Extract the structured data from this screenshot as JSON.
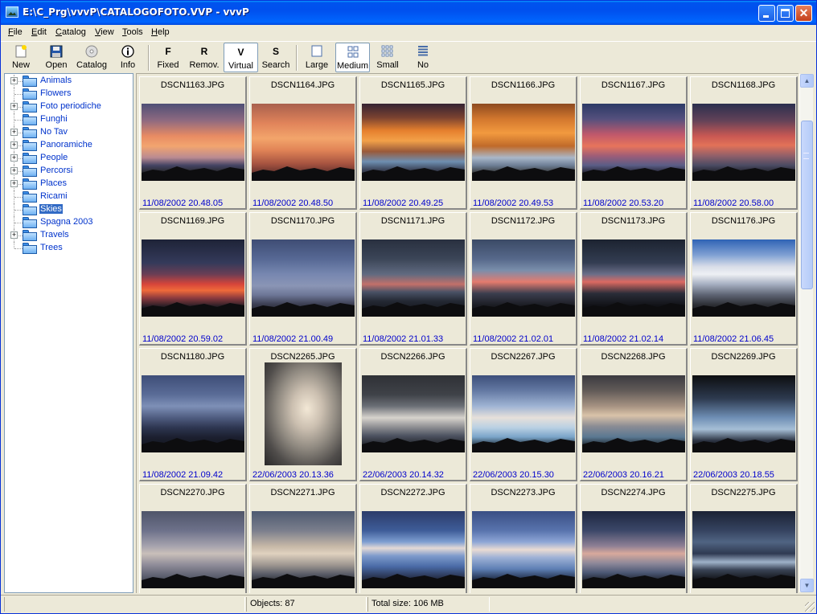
{
  "window": {
    "title": "E:\\C_Prg\\vvvP\\CATALOGOFOTO.VVP - vvvP"
  },
  "menu": [
    {
      "label": "File",
      "accel": "F",
      "rest": "ile"
    },
    {
      "label": "Edit",
      "accel": "E",
      "rest": "dit"
    },
    {
      "label": "Catalog",
      "accel": "C",
      "rest": "atalog"
    },
    {
      "label": "View",
      "accel": "V",
      "rest": "iew"
    },
    {
      "label": "Tools",
      "accel": "T",
      "rest": "ools"
    },
    {
      "label": "Help",
      "accel": "H",
      "rest": "elp"
    }
  ],
  "toolbar": {
    "new": "New",
    "open": "Open",
    "catalog": "Catalog",
    "info": "Info",
    "fixed_letter": "F",
    "fixed": "Fixed",
    "removable_letter": "R",
    "removable": "Remov.",
    "virtual_letter": "V",
    "virtual": "Virtual",
    "search_letter": "S",
    "search": "Search",
    "large": "Large",
    "medium": "Medium",
    "small": "Small",
    "no": "No",
    "active_items": [
      "Virtual",
      "Medium"
    ]
  },
  "tree": [
    {
      "label": "Animals",
      "expandable": true
    },
    {
      "label": "Flowers",
      "expandable": false
    },
    {
      "label": "Foto periodiche",
      "expandable": true
    },
    {
      "label": "Funghi",
      "expandable": false
    },
    {
      "label": "No Tav",
      "expandable": true
    },
    {
      "label": "Panoramiche",
      "expandable": true
    },
    {
      "label": "People",
      "expandable": true
    },
    {
      "label": "Percorsi",
      "expandable": true
    },
    {
      "label": "Places",
      "expandable": true
    },
    {
      "label": "Ricami",
      "expandable": false
    },
    {
      "label": "Skies",
      "expandable": false,
      "selected": true
    },
    {
      "label": "Spagna 2003",
      "expandable": false
    },
    {
      "label": "Travels",
      "expandable": true
    },
    {
      "label": "Trees",
      "expandable": false
    }
  ],
  "thumbnails": [
    {
      "name": "DSCN1163.JPG",
      "date": "11/08/2002 20.48.05",
      "style": "orange-sky"
    },
    {
      "name": "DSCN1164.JPG",
      "date": "11/08/2002 20.48.50",
      "style": "orange-full"
    },
    {
      "name": "DSCN1165.JPG",
      "date": "11/08/2002 20.49.25",
      "style": "orange-dramatic"
    },
    {
      "name": "DSCN1166.JPG",
      "date": "11/08/2002 20.49.53",
      "style": "orange-dramatic2"
    },
    {
      "name": "DSCN1167.JPG",
      "date": "11/08/2002 20.53.20",
      "style": "red-dusk"
    },
    {
      "name": "DSCN1168.JPG",
      "date": "11/08/2002 20.58.00",
      "style": "red-dusk-tree"
    },
    {
      "name": "DSCN1169.JPG",
      "date": "11/08/2002 20.59.02",
      "style": "red-band"
    },
    {
      "name": "DSCN1170.JPG",
      "date": "11/08/2002 21.00.49",
      "style": "blue-dusk"
    },
    {
      "name": "DSCN1171.JPG",
      "date": "11/08/2002 21.01.33",
      "style": "dark-cloud"
    },
    {
      "name": "DSCN1172.JPG",
      "date": "11/08/2002 21.02.01",
      "style": "dark-pink"
    },
    {
      "name": "DSCN1173.JPG",
      "date": "11/08/2002 21.02.14",
      "style": "dark-pink2"
    },
    {
      "name": "DSCN1176.JPG",
      "date": "11/08/2002 21.06.45",
      "style": "white-clouds"
    },
    {
      "name": "DSCN1180.JPG",
      "date": "11/08/2002 21.09.42",
      "style": "blue-clouds"
    },
    {
      "name": "DSCN2265.JPG",
      "date": "22/06/2003 20.13.36",
      "style": "portrait-grey",
      "portrait": true
    },
    {
      "name": "DSCN2266.JPG",
      "date": "22/06/2003 20.14.32",
      "style": "grey-storm"
    },
    {
      "name": "DSCN2267.JPG",
      "date": "22/06/2003 20.15.30",
      "style": "cyan-sky"
    },
    {
      "name": "DSCN2268.JPG",
      "date": "22/06/2003 20.16.21",
      "style": "brown-sky"
    },
    {
      "name": "DSCN2269.JPG",
      "date": "22/06/2003 20.18.55",
      "style": "tree-silhouette"
    },
    {
      "name": "DSCN2270.JPG",
      "date": "",
      "style": "grey-soft"
    },
    {
      "name": "DSCN2271.JPG",
      "date": "",
      "style": "warm-grey"
    },
    {
      "name": "DSCN2272.JPG",
      "date": "",
      "style": "blue-streak"
    },
    {
      "name": "DSCN2273.JPG",
      "date": "",
      "style": "blue-streak2"
    },
    {
      "name": "DSCN2274.JPG",
      "date": "",
      "style": "pink-grey"
    },
    {
      "name": "DSCN2275.JPG",
      "date": "",
      "style": "dark-horizon"
    }
  ],
  "status": {
    "empty": "",
    "objects": "Objects: 87",
    "total": "Total size: 106 MB"
  }
}
